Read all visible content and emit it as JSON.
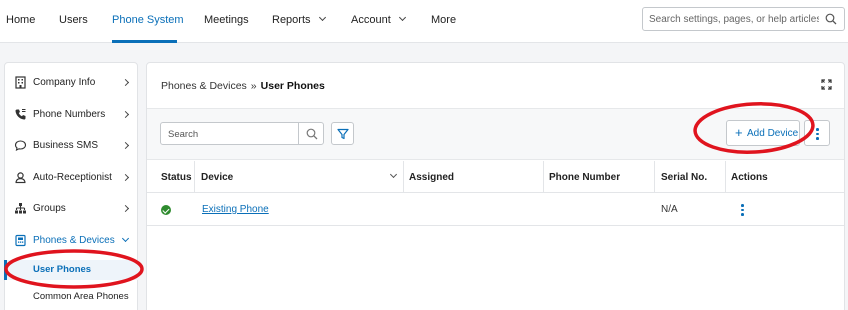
{
  "nav": {
    "items": [
      {
        "label": "Home"
      },
      {
        "label": "Users"
      },
      {
        "label": "Phone System"
      },
      {
        "label": "Meetings"
      },
      {
        "label": "Reports"
      },
      {
        "label": "Account"
      },
      {
        "label": "More"
      }
    ],
    "search_placeholder": "Search settings, pages, or help articles"
  },
  "sidebar": {
    "items": [
      {
        "label": "Company Info",
        "icon": "building-icon"
      },
      {
        "label": "Phone Numbers",
        "icon": "phone-icon"
      },
      {
        "label": "Business SMS",
        "icon": "chat-bubble-icon"
      },
      {
        "label": "Auto-Receptionist",
        "icon": "receptionist-icon"
      },
      {
        "label": "Groups",
        "icon": "org-chart-icon"
      },
      {
        "label": "Phones & Devices",
        "icon": "desk-phone-icon"
      }
    ],
    "sub_items": [
      {
        "label": "User Phones"
      },
      {
        "label": "Common Area Phones"
      }
    ]
  },
  "breadcrumb": {
    "parent": "Phones & Devices",
    "separator": "»",
    "current": "User Phones"
  },
  "toolbar": {
    "search_placeholder": "Search",
    "add_label": "Add Device",
    "add_icon": "+"
  },
  "table": {
    "columns": [
      "Status",
      "Device",
      "Assigned",
      "Phone Number",
      "Serial No.",
      "Actions"
    ],
    "rows": [
      {
        "status": "online",
        "device": "Existing Phone",
        "assigned": "",
        "phone_number": "",
        "serial": "N/A"
      }
    ]
  },
  "colors": {
    "accent": "#0a6fb8",
    "status_ok": "#2e8b2e",
    "annotation": "#e0141e"
  }
}
